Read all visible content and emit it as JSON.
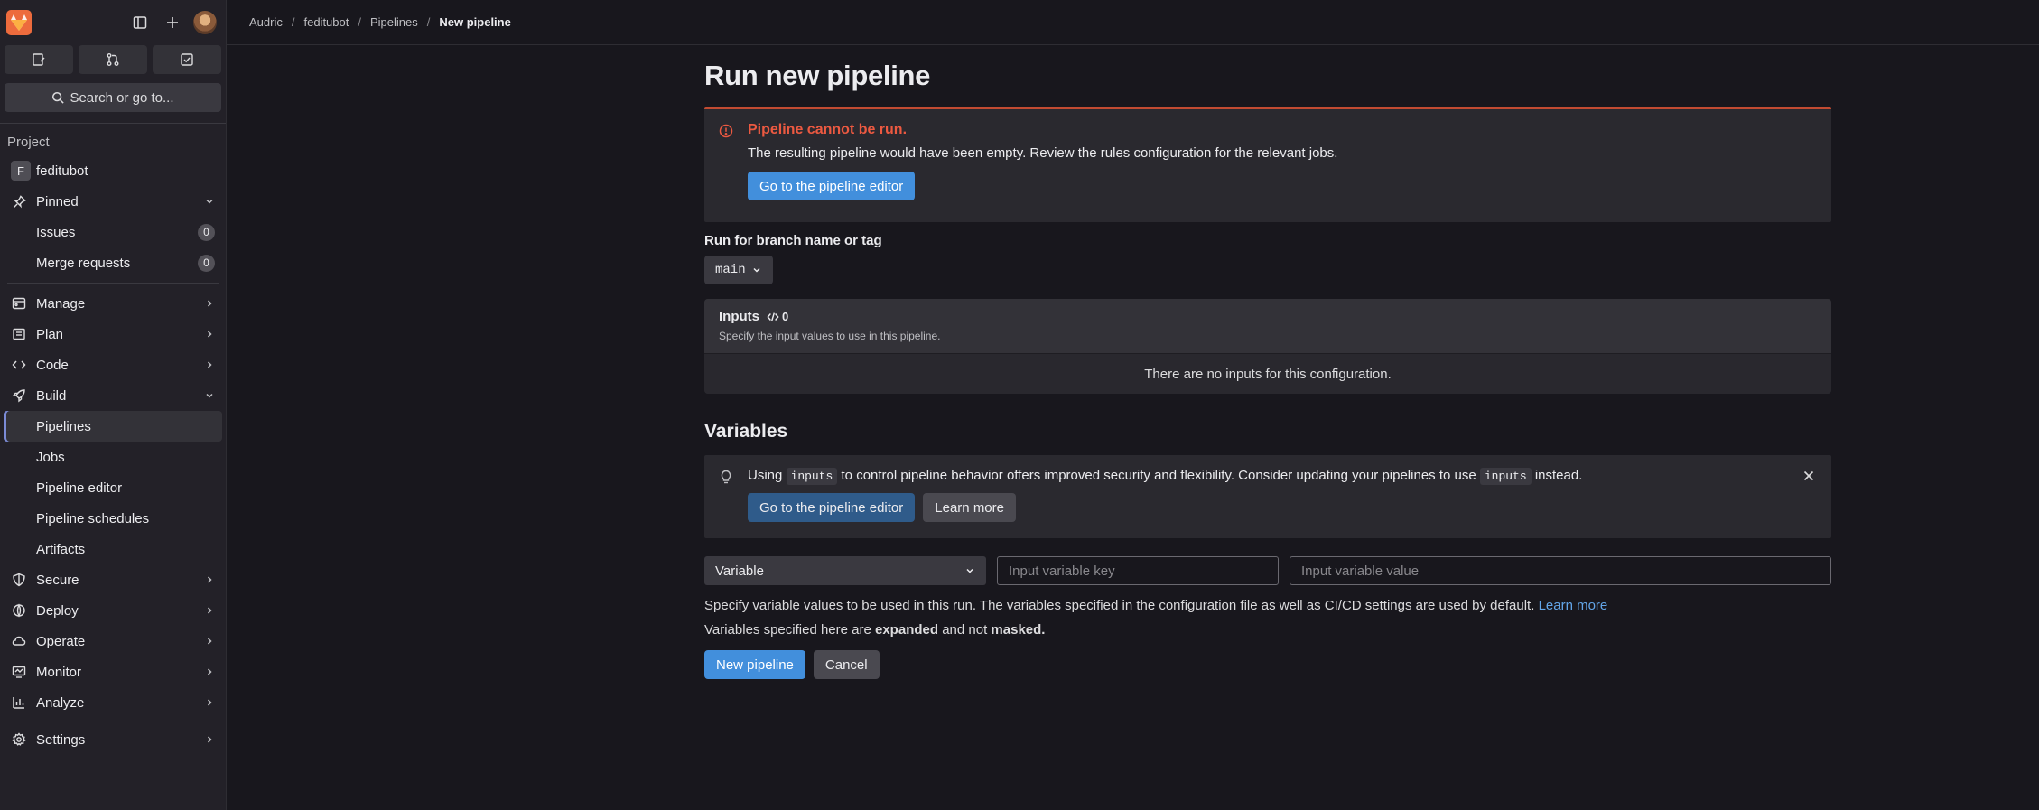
{
  "sidebar": {
    "search_label": "Search or go to...",
    "section_title": "Project",
    "project": {
      "initial": "F",
      "name": "feditubot"
    },
    "pinned": {
      "label": "Pinned",
      "items": [
        {
          "label": "Issues",
          "count": "0"
        },
        {
          "label": "Merge requests",
          "count": "0"
        }
      ]
    },
    "manage": "Manage",
    "plan": "Plan",
    "code": "Code",
    "build": {
      "label": "Build",
      "items": [
        "Pipelines",
        "Jobs",
        "Pipeline editor",
        "Pipeline schedules",
        "Artifacts"
      ],
      "active": "Pipelines"
    },
    "secure": "Secure",
    "deploy": "Deploy",
    "operate": "Operate",
    "monitor": "Monitor",
    "analyze": "Analyze",
    "settings": "Settings"
  },
  "breadcrumb": [
    "Audric",
    "feditubot",
    "Pipelines",
    "New pipeline"
  ],
  "page": {
    "title": "Run new pipeline",
    "error": {
      "title": "Pipeline cannot be run.",
      "body": "The resulting pipeline would have been empty. Review the rules configuration for the relevant jobs.",
      "button": "Go to the pipeline editor"
    },
    "branch_label": "Run for branch name or tag",
    "branch_value": "main",
    "inputs": {
      "title": "Inputs",
      "count": "0",
      "subtitle": "Specify the input values to use in this pipeline.",
      "empty": "There are no inputs for this configuration."
    },
    "variables": {
      "title": "Variables",
      "tip": {
        "text_1": "Using",
        "code_1": "inputs",
        "text_2": "to control pipeline behavior offers improved security and flexibility. Consider updating your pipelines to use",
        "code_2": "inputs",
        "text_3": "instead.",
        "button_primary": "Go to the pipeline editor",
        "button_secondary": "Learn more"
      },
      "type_value": "Variable",
      "key_placeholder": "Input variable key",
      "value_placeholder": "Input variable value",
      "help_text": "Specify variable values to be used in this run. The variables specified in the configuration file as well as CI/CD settings are used by default.",
      "help_link": "Learn more",
      "help2_a": "Variables specified here are",
      "help2_b": "expanded",
      "help2_c": "and not",
      "help2_d": "masked."
    },
    "submit": "New pipeline",
    "cancel": "Cancel"
  }
}
